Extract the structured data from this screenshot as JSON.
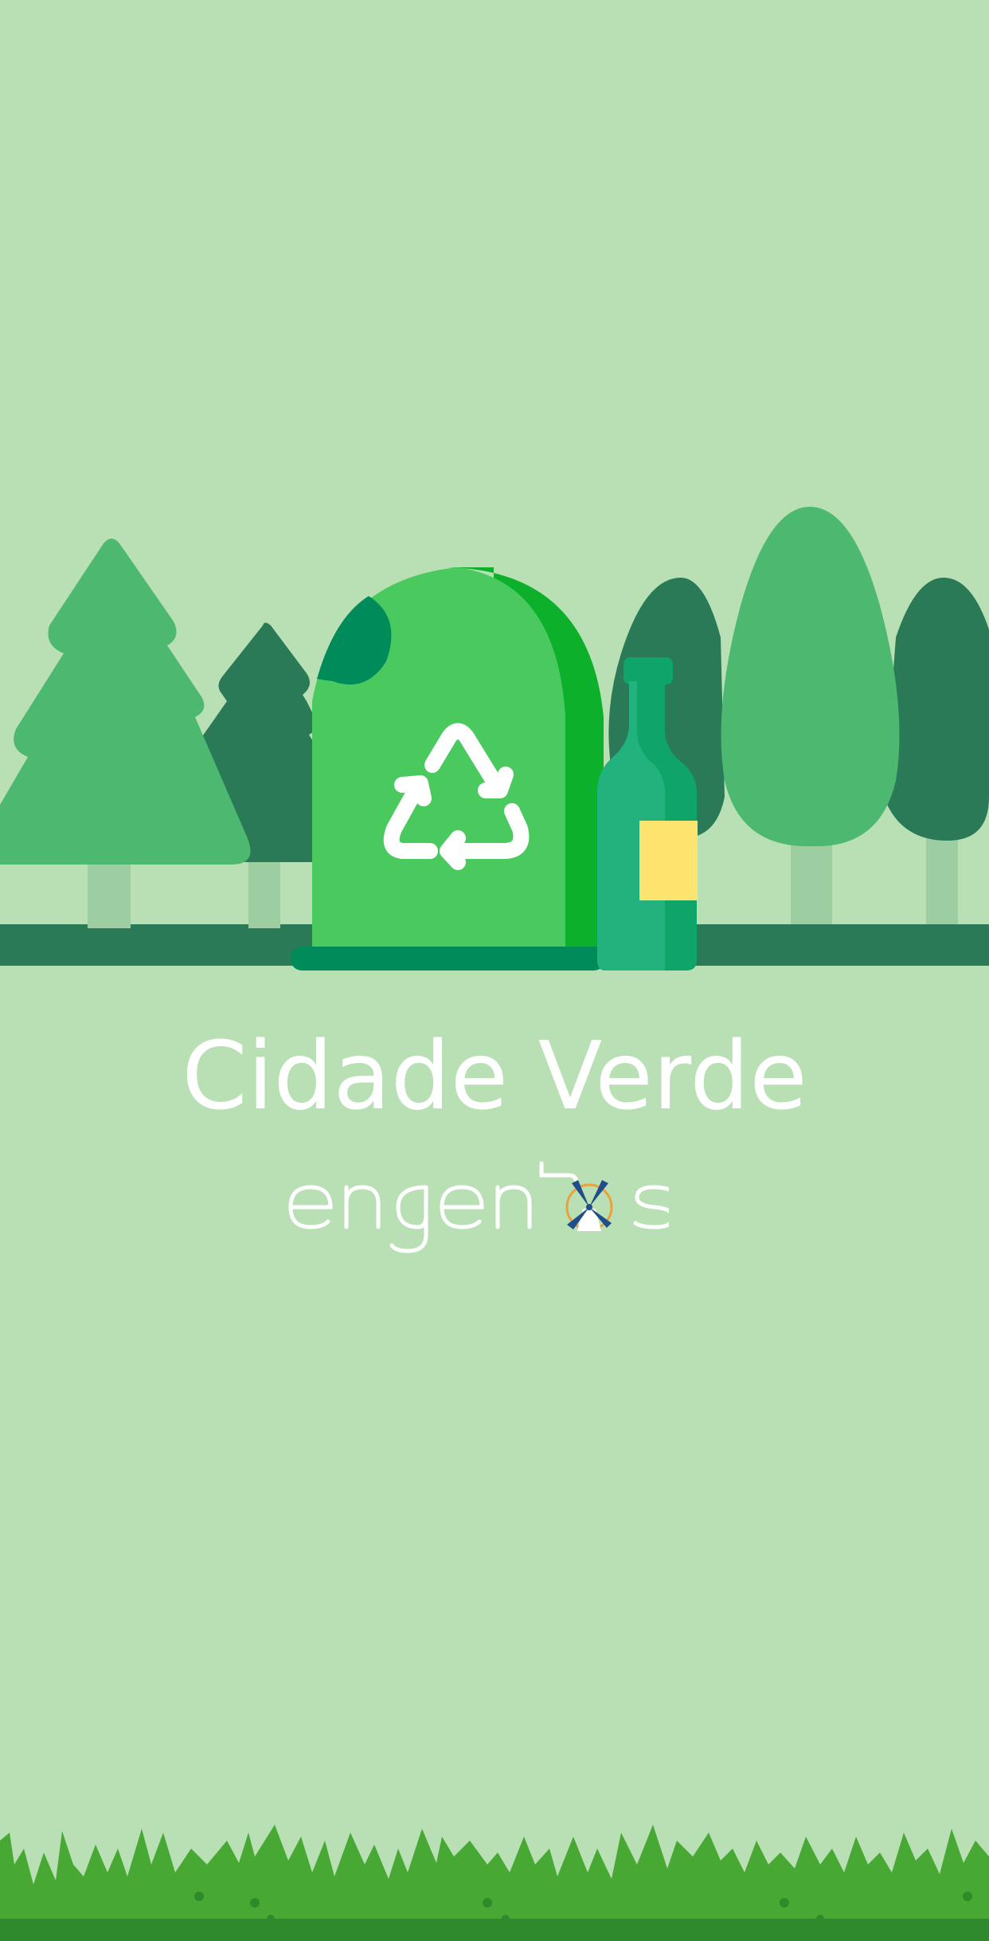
{
  "splash": {
    "title": "Cidade Verde",
    "brand": "engenhos"
  },
  "colors": {
    "background": "#b8e0b4",
    "ground": "#2b7a57",
    "tree_light": "#4cb870",
    "tree_dark": "#2b7a57",
    "trunk": "#9dcea2",
    "bin_body": "#4aca5e",
    "bin_shadow": "#0db02b",
    "bin_base": "#008c5a",
    "bottle": "#22b27e",
    "bottle_label": "#fde46e",
    "grass": "#47a834",
    "grass_dark": "#2e8a2b",
    "text": "#ffffff"
  },
  "icons": [
    "recycle-icon",
    "windmill-icon",
    "glass-bottle-icon",
    "recycling-bin-icon"
  ]
}
